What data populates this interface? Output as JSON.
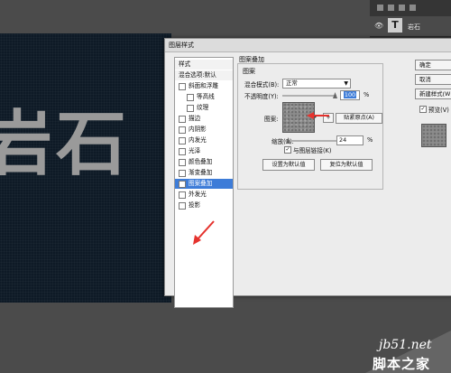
{
  "canvas": {
    "text": "岩石"
  },
  "layers_panel": {
    "layer_name": "岩石",
    "layer_type": "T"
  },
  "dialog": {
    "title": "图层样式",
    "styles_list": [
      {
        "label": "样式",
        "type": "header"
      },
      {
        "label": "混合选项:默认",
        "type": "header"
      },
      {
        "label": "斜面和浮雕",
        "checked": false
      },
      {
        "label": "等高线",
        "checked": false,
        "indent": true
      },
      {
        "label": "纹理",
        "checked": false,
        "indent": true
      },
      {
        "label": "描边",
        "checked": false
      },
      {
        "label": "内阴影",
        "checked": false
      },
      {
        "label": "内发光",
        "checked": false
      },
      {
        "label": "光泽",
        "checked": false
      },
      {
        "label": "颜色叠加",
        "checked": false
      },
      {
        "label": "渐变叠加",
        "checked": false
      },
      {
        "label": "图案叠加",
        "checked": true,
        "selected": true
      },
      {
        "label": "外发光",
        "checked": false
      },
      {
        "label": "投影",
        "checked": false
      }
    ],
    "group_title": "图案叠加",
    "fieldset_legend": "图案",
    "blend_mode_label": "混合模式(B):",
    "blend_mode_value": "正常",
    "opacity_label": "不透明度(Y):",
    "opacity_value": "100",
    "opacity_unit": "%",
    "pattern_label": "图案:",
    "new_preset_label": "+",
    "snap_origin_button": "贴紧原点(A)",
    "scale_label": "缩放(S):",
    "scale_value": "24",
    "scale_unit": "%",
    "link_layer_label": "与图层链接(K)",
    "link_layer_checked": true,
    "set_default_button": "设置为默认值",
    "reset_default_button": "复位为默认值",
    "ok_button": "确定",
    "cancel_button": "取消",
    "new_style_button": "新建样式(W)...",
    "preview_label": "预览(V)",
    "preview_checked": true
  },
  "watermark": {
    "url": "jb51.net",
    "text": "脚本之家"
  },
  "colors": {
    "annotation_arrow": "#e5322d",
    "selection": "#3d7cd8"
  }
}
